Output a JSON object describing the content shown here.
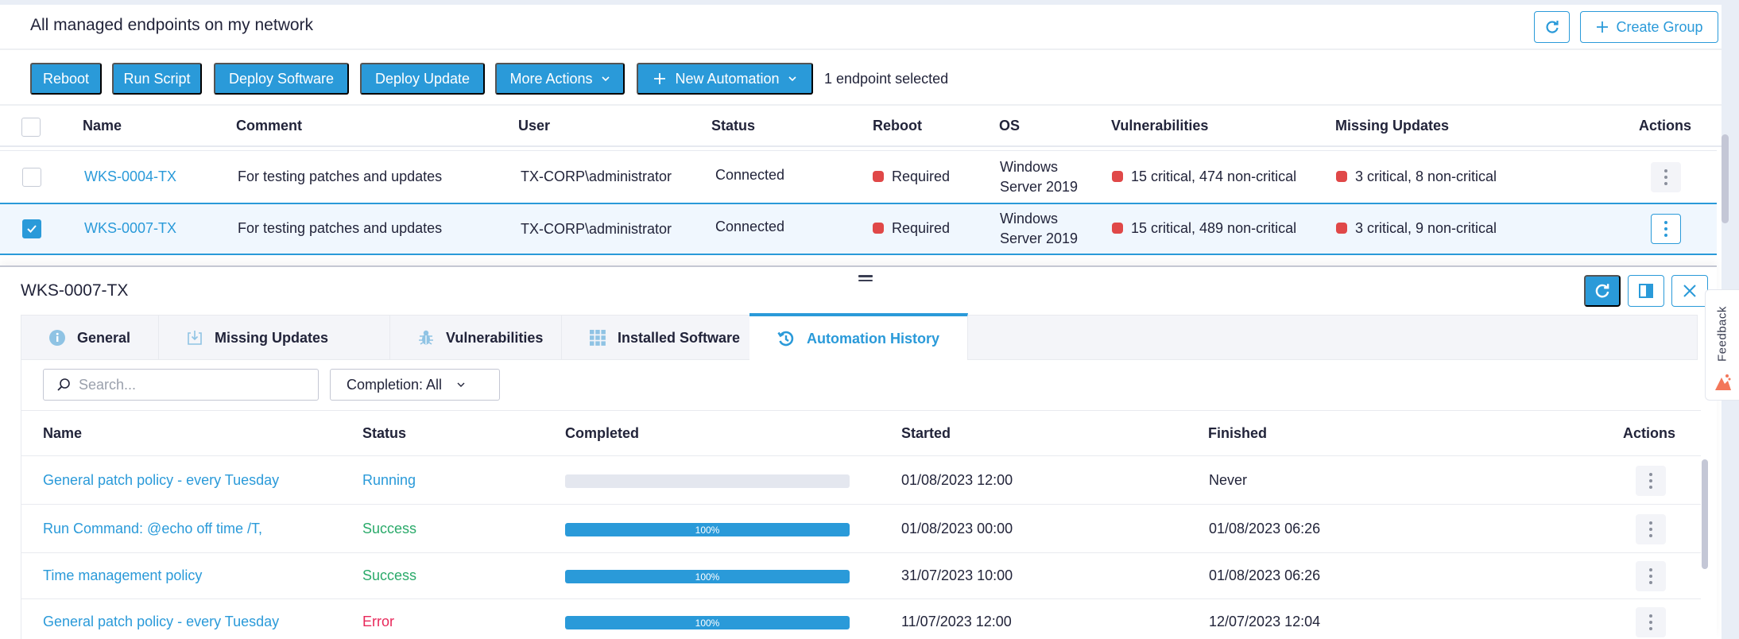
{
  "header": {
    "title": "All managed endpoints on my network",
    "create_group_label": "Create Group"
  },
  "toolbar": {
    "buttons": [
      "Reboot",
      "Run Script",
      "Deploy Software",
      "Deploy Update",
      "More Actions",
      "New Automation"
    ],
    "selection_text": "1 endpoint selected"
  },
  "endpoints": {
    "columns": [
      "Name",
      "Comment",
      "User",
      "Status",
      "Reboot",
      "OS",
      "Vulnerabilities",
      "Missing Updates",
      "Actions"
    ],
    "rows": [
      {
        "selected": false,
        "name": "WKS-0004-TX",
        "comment": "For testing patches and updates",
        "user": "TX-CORP\\administrator",
        "status": "Connected",
        "reboot": "Required",
        "os_line1": "Windows",
        "os_line2": "Server 2019",
        "vulnerabilities": "15 critical,  474 non-critical",
        "missing_updates": "3 critical,  8 non-critical"
      },
      {
        "selected": true,
        "name": "WKS-0007-TX",
        "comment": "For testing patches and updates",
        "user": "TX-CORP\\administrator",
        "status": "Connected",
        "reboot": "Required",
        "os_line1": "Windows",
        "os_line2": "Server 2019",
        "vulnerabilities": "15 critical,  489 non-critical",
        "missing_updates": "3 critical,  9 non-critical"
      }
    ]
  },
  "detail": {
    "title": "WKS-0007-TX",
    "tabs": [
      {
        "label": "General",
        "icon": "info-icon",
        "active": false
      },
      {
        "label": "Missing Updates",
        "icon": "download-tray-icon",
        "active": false
      },
      {
        "label": "Vulnerabilities",
        "icon": "bug-icon",
        "active": false
      },
      {
        "label": "Installed Software",
        "icon": "grid-icon",
        "active": false
      },
      {
        "label": "Automation History",
        "icon": "history-icon",
        "active": true
      }
    ],
    "search_placeholder": "Search...",
    "filter_label": "Completion: All",
    "history": {
      "columns": [
        "Name",
        "Status",
        "Completed",
        "Started",
        "Finished",
        "Actions"
      ],
      "rows": [
        {
          "name": "General patch policy - every Tuesday",
          "status": "Running",
          "progress": 0,
          "progress_label": "",
          "started": "01/08/2023 12:00",
          "finished": "Never"
        },
        {
          "name": "Run Command: @echo off time /T,",
          "status": "Success",
          "progress": 100,
          "progress_label": "100%",
          "started": "01/08/2023 00:00",
          "finished": "01/08/2023 06:26"
        },
        {
          "name": "Time management policy",
          "status": "Success",
          "progress": 100,
          "progress_label": "100%",
          "started": "31/07/2023 10:00",
          "finished": "01/08/2023 06:26"
        },
        {
          "name": "General patch policy - every Tuesday",
          "status": "Error",
          "progress": 100,
          "progress_label": "100%",
          "started": "11/07/2023 12:00",
          "finished": "12/07/2023 12:04"
        }
      ]
    }
  },
  "feedback": {
    "label": "Feedback"
  },
  "colors": {
    "accent": "#2a9ad9",
    "critical": "#e04848",
    "success": "#2aaa6a",
    "error": "#e8285a"
  }
}
